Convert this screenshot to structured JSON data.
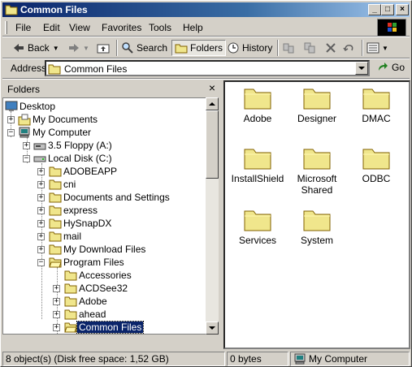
{
  "window": {
    "title": "Common Files",
    "controls": {
      "minimize": "_",
      "maximize": "□",
      "close": "×"
    }
  },
  "menu": [
    "File",
    "Edit",
    "View",
    "Favorites",
    "Tools",
    "Help"
  ],
  "toolbar": {
    "back_label": "Back",
    "search_label": "Search",
    "folders_label": "Folders",
    "history_label": "History"
  },
  "address": {
    "label": "Address",
    "value": "Common Files",
    "go_label": "Go"
  },
  "folders_panel": {
    "title": "Folders",
    "close": "×"
  },
  "tree": [
    {
      "label": "Desktop",
      "icon": "desktop-icon",
      "expander": ""
    },
    {
      "label": "My Documents",
      "icon": "my-documents-icon",
      "expander": "+"
    },
    {
      "label": "My Computer",
      "icon": "my-computer-icon",
      "expander": "−"
    },
    {
      "label": "3.5 Floppy (A:)",
      "icon": "floppy-icon",
      "expander": "+"
    },
    {
      "label": "Local Disk (C:)",
      "icon": "hard-disk-icon",
      "expander": "−"
    },
    {
      "label": "ADOBEAPP",
      "icon": "folder-icon",
      "expander": "+"
    },
    {
      "label": "cni",
      "icon": "folder-icon",
      "expander": "+"
    },
    {
      "label": "Documents and Settings",
      "icon": "folder-icon",
      "expander": "+"
    },
    {
      "label": "express",
      "icon": "folder-icon",
      "expander": "+"
    },
    {
      "label": "HySnapDX",
      "icon": "folder-icon",
      "expander": "+"
    },
    {
      "label": "mail",
      "icon": "folder-icon",
      "expander": "+"
    },
    {
      "label": "My Download Files",
      "icon": "folder-icon",
      "expander": "+"
    },
    {
      "label": "Program Files",
      "icon": "folder-open-icon",
      "expander": "−"
    },
    {
      "label": "Accessories",
      "icon": "folder-icon",
      "expander": ""
    },
    {
      "label": "ACDSee32",
      "icon": "folder-icon",
      "expander": "+"
    },
    {
      "label": "Adobe",
      "icon": "folder-icon",
      "expander": "+"
    },
    {
      "label": "ahead",
      "icon": "folder-icon",
      "expander": "+"
    },
    {
      "label": "Common Files",
      "icon": "folder-open-icon",
      "expander": "+",
      "selected": true
    }
  ],
  "content_items": [
    "Adobe",
    "Designer",
    "DMAC",
    "InstallShield",
    "Microsoft Shared",
    "ODBC",
    "Services",
    "System"
  ],
  "status": {
    "objects": "8 object(s) (Disk free space: 1,52 GB)",
    "size": "0 bytes",
    "zone": "My Computer"
  },
  "colors": {
    "face": "#d4d0c8",
    "title_active": "#0a246a",
    "folder_yellow": "#f0e68c",
    "selection": "#0a246a"
  }
}
